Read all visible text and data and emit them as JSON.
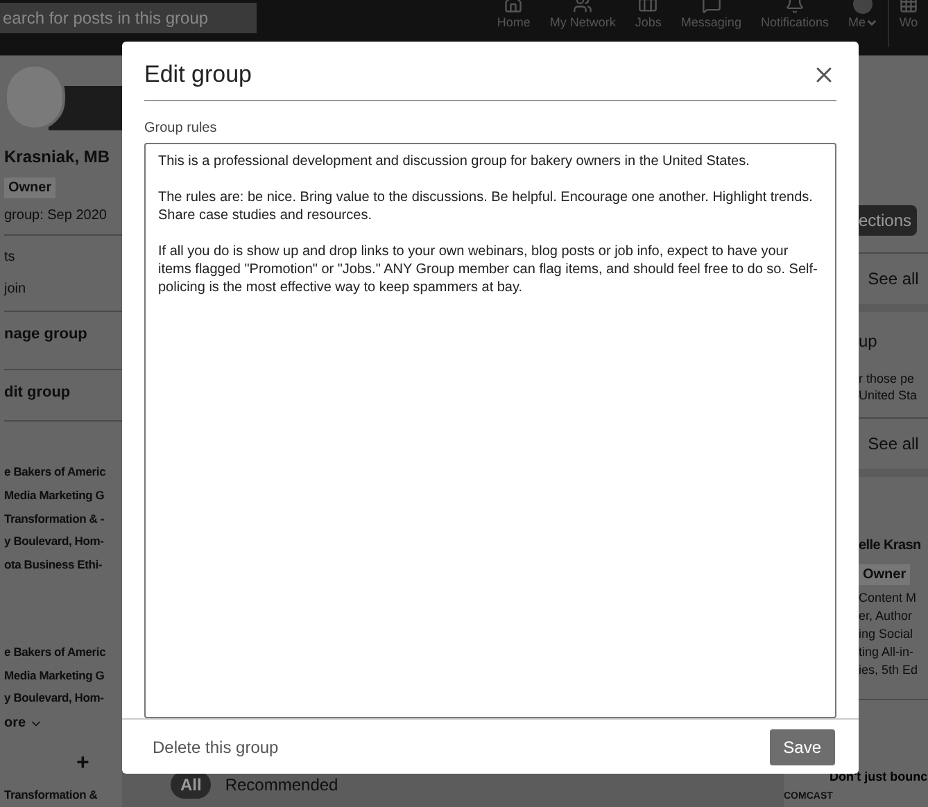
{
  "top_bar": {
    "search": {
      "placeholder": "earch for posts in this group"
    },
    "nav": [
      {
        "label": "Home",
        "kind": "home"
      },
      {
        "label": "My Network",
        "kind": "network"
      },
      {
        "label": "Jobs",
        "kind": "jobs"
      },
      {
        "label": "Messaging",
        "kind": "messaging"
      },
      {
        "label": "Notifications",
        "kind": "notifications"
      },
      {
        "label": "Me",
        "kind": "me"
      },
      {
        "label": "Wo",
        "kind": "work"
      }
    ]
  },
  "left_panel": {
    "profile": {
      "name": "Krasniak, MB",
      "badge": "Owner",
      "joined": "group: Sep 2020"
    },
    "links": [
      "ts",
      "join"
    ],
    "actions": [
      "nage group",
      "dit group"
    ],
    "group_lists": [
      {
        "items": [
          "e Bakers of Americ",
          "Media Marketing G",
          "Transformation & -",
          "y Boulevard, Hom-",
          "ota Business Ethi-"
        ]
      },
      {
        "items": [
          "e Bakers of Americ",
          "Media Marketing G",
          "y Boulevard, Hom-"
        ],
        "more": "ore"
      }
    ],
    "add_button": "+",
    "footer_text": "Transformation &"
  },
  "feed": {
    "filters": [
      {
        "label": "All",
        "selected": true
      },
      {
        "label": "Recommended",
        "selected": false
      }
    ]
  },
  "right_panel": {
    "button": "ections",
    "see_all": [
      "See all",
      "See all"
    ],
    "group_title": "up",
    "group_desc": [
      "r those pe",
      "United Sta"
    ],
    "owner": {
      "name": "elle Krasn",
      "badge": "Owner",
      "bio": [
        "Content M",
        "er, Author",
        "ing Social",
        "ting All-in-",
        "ies, 5th Ed"
      ]
    },
    "ad": {
      "title": "Don't just bounc",
      "brand": "COMCAST"
    }
  },
  "dialog": {
    "title": "Edit group",
    "field": {
      "label": "Group rules",
      "value": "This is a professional development and discussion group for bakery owners in the United States.\n\nThe rules are: be nice. Bring value to the discussions. Be helpful. Encourage one another. Highlight trends. Share case studies and resources.\n\nIf all you do is show up and drop links to your own webinars, blog posts or job info, expect to have your items flagged \"Promotion\" or \"Jobs.\" ANY Group member can flag items, and should feel free to do so. Self-policing is the most effective way to keep spammers at bay."
    },
    "delete": "Delete this group",
    "save": "Save"
  }
}
